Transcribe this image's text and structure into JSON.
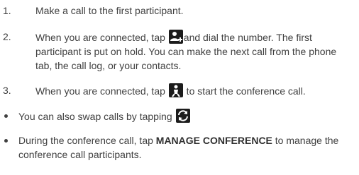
{
  "steps": [
    {
      "number": "1.",
      "text": "Make a call to the first participant."
    },
    {
      "number": "2.",
      "before_icon": "When you are connected, tap ",
      "icon": "add-call-icon",
      "after_icon": "and dial the number. The first participant is put on hold. You can make the next call from the phone tab, the call log, or your contacts."
    },
    {
      "number": "3.",
      "before_icon": "When you are connected, tap ",
      "icon": "merge-calls-icon",
      "after_icon": " to start the conference call."
    }
  ],
  "bullets": [
    {
      "before_icon": "You can also swap calls by tapping ",
      "icon": "swap-calls-icon",
      "after_icon": ""
    },
    {
      "before_bold": "During the conference call, tap ",
      "bold": "MANAGE CONFERENCE",
      "after_bold": " to manage the conference call participants."
    }
  ],
  "colors": {
    "text": "#404040",
    "icon_bg": "#1c1c1c",
    "icon_fg": "#ffffff"
  }
}
